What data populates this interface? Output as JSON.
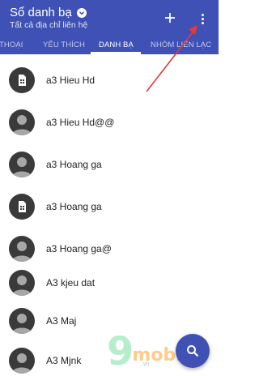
{
  "header": {
    "title": "Sổ danh bạ",
    "subtitle": "Tất cả địa chỉ liên hệ",
    "title_icon": "chevron-down-icon",
    "actions": [
      {
        "name": "add",
        "icon": "plus-icon"
      },
      {
        "name": "more",
        "icon": "more-vertical-icon"
      }
    ],
    "color": "#3f51b5"
  },
  "tabs": [
    {
      "label": "THOẠI",
      "active": false
    },
    {
      "label": "YÊU THÍCH",
      "active": false
    },
    {
      "label": "DANH BẠ",
      "active": true
    },
    {
      "label": "NHÓM LIÊN LẠC",
      "active": false
    }
  ],
  "contacts": [
    {
      "name": "a3 Hieu Hd",
      "avatar": "sim-card-icon"
    },
    {
      "name": "a3 Hieu Hd@@",
      "avatar": "person-icon"
    },
    {
      "name": "a3 Hoang ga",
      "avatar": "person-icon"
    },
    {
      "name": "a3 Hoang ga",
      "avatar": "sim-card-icon"
    },
    {
      "name": "a3 Hoang ga@",
      "avatar": "person-icon"
    },
    {
      "name": "A3 kjeu dat",
      "avatar": "person-icon"
    },
    {
      "name": "A3 Maj",
      "avatar": "person-icon"
    },
    {
      "name": "A3 Mjnk",
      "avatar": "person-icon"
    }
  ],
  "fab": {
    "icon": "search-icon"
  },
  "annotation": {
    "icon": "red-arrow-icon",
    "color": "#e53935"
  },
  "watermark": {
    "digit": "9",
    "text": "mobi",
    "domain": ".vn"
  }
}
